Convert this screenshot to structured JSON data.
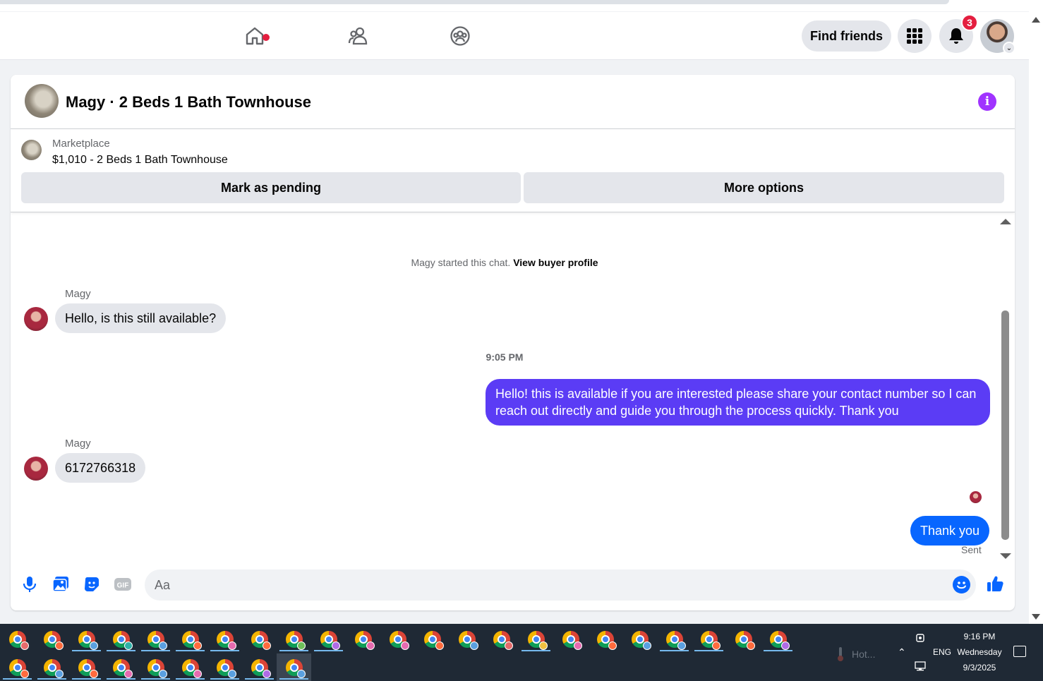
{
  "header": {
    "nav": [
      {
        "name": "home",
        "icon": "home-icon"
      },
      {
        "name": "friends",
        "icon": "friends-icon"
      },
      {
        "name": "groups",
        "icon": "groups-icon"
      }
    ],
    "find_friends_label": "Find friends",
    "notification_count": "3",
    "icons": [
      "menu-grid-icon",
      "bell-icon",
      "chevron-down-icon"
    ]
  },
  "chat": {
    "title": "Magy · 2 Beds 1 Bath Townhouse",
    "info_icon": "i",
    "marketplace_label": "Marketplace",
    "listing": "$1,010 - 2 Beds 1 Bath Townhouse",
    "mark_pending_label": "Mark as pending",
    "more_options_label": "More options",
    "started_text": "Magy started this chat.",
    "view_profile_label": "View buyer profile",
    "messages": [
      {
        "sender": "Magy",
        "text": "Hello, is this still available?"
      },
      {
        "timestamp": "9:05 PM"
      },
      {
        "sender": "me",
        "text": "Hello! this is available if you are interested please share your contact number so I can reach out directly and guide you through the process quickly. Thank you"
      },
      {
        "sender": "Magy",
        "text": "6172766318"
      },
      {
        "sender": "me",
        "text": "Thank you"
      }
    ],
    "status": "Sent",
    "composer_placeholder": "Aa",
    "gif_label": "GIF",
    "colors": {
      "outgoing": "#5b3cf5",
      "outgoing_latest": "#0866ff",
      "accent": "#0866ff",
      "info": "#a033ff"
    }
  },
  "taskbar": {
    "weather": "Hot...",
    "language": "ENG",
    "time": "9:16 PM",
    "day": "Wednesday",
    "date": "9/3/2025"
  }
}
